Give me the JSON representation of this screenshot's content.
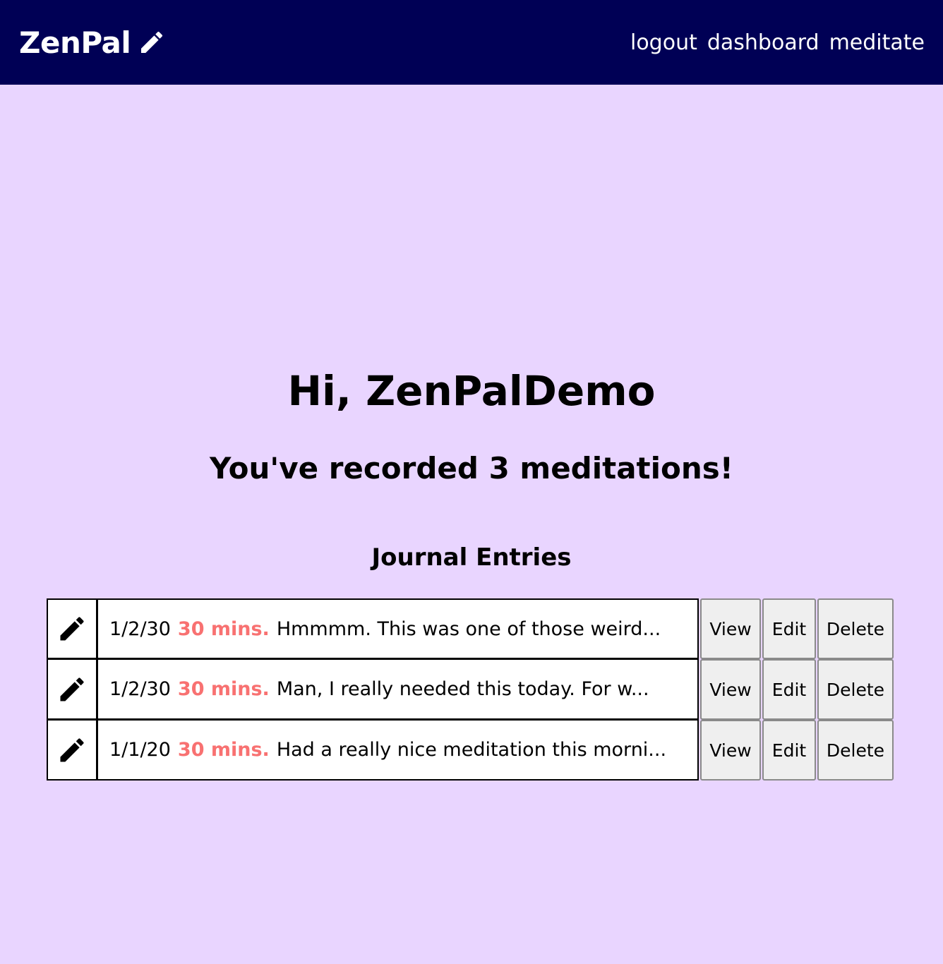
{
  "navbar": {
    "brand": "ZenPal",
    "brand_icon": "pencil-icon",
    "links": [
      "logout",
      "dashboard",
      "meditate"
    ],
    "background": "#000055"
  },
  "main": {
    "greeting": "Hi, ZenPalDemo",
    "count_text": "You've recorded 3 meditations!",
    "journal_heading": "Journal Entries",
    "background": "#e9d5ff",
    "duration_color": "#f87171"
  },
  "entries": [
    {
      "icon": "pencil-icon",
      "date": "1/2/30",
      "duration": "30 mins.",
      "preview": "Hmmmm. This was one of those weird...",
      "view_label": "View",
      "edit_label": "Edit",
      "delete_label": "Delete"
    },
    {
      "icon": "pencil-icon",
      "date": "1/2/30",
      "duration": "30 mins.",
      "preview": "Man, I really needed this today. For w...",
      "view_label": "View",
      "edit_label": "Edit",
      "delete_label": "Delete"
    },
    {
      "icon": "pencil-icon",
      "date": "1/1/20",
      "duration": "30 mins.",
      "preview": "Had a really nice meditation this morni...",
      "view_label": "View",
      "edit_label": "Edit",
      "delete_label": "Delete"
    }
  ]
}
